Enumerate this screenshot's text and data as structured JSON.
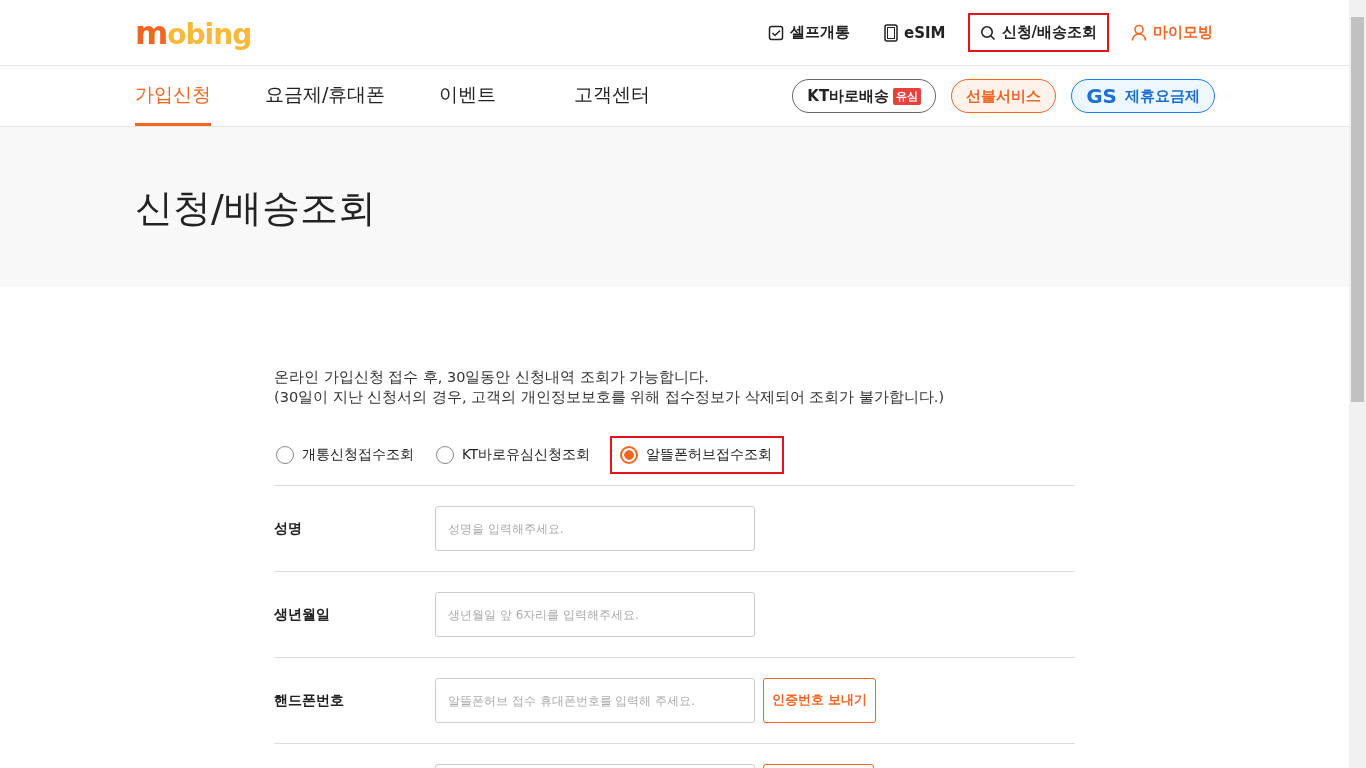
{
  "header": {
    "logo": "mobing",
    "utility_links": [
      {
        "kind": "check",
        "label": "셀프개통",
        "highlighted": false
      },
      {
        "kind": "sim",
        "label": "eSIM",
        "highlighted": false
      },
      {
        "kind": "search",
        "label": "신청/배송조회",
        "highlighted": true
      },
      {
        "kind": "user",
        "label": "마이모빙",
        "highlighted": false
      }
    ]
  },
  "nav": {
    "tabs": [
      {
        "label": "가입신청",
        "selected": true
      },
      {
        "label": "요금제/휴대폰",
        "selected": false
      },
      {
        "label": "이벤트",
        "selected": false
      },
      {
        "label": "고객센터",
        "selected": false
      }
    ],
    "pills": [
      {
        "kind": "kt",
        "label": "KT바로배송",
        "badge": "유심"
      },
      {
        "kind": "prepaid",
        "label": "선불서비스"
      },
      {
        "kind": "gs",
        "prefix": "GS",
        "label": "제휴요금제"
      }
    ]
  },
  "page_title": "신청/배송조회",
  "notice": [
    "온라인 가입신청 접수 후, 30일동안 신청내역 조회가 가능합니다.",
    "(30일이 지난 신청서의 경우, 고객의 개인정보보호를 위해 접수정보가 삭제되어 조회가 불가합니다.)"
  ],
  "lookup_types": [
    {
      "label": "개통신청접수조회",
      "selected": false,
      "highlighted": false
    },
    {
      "label": "KT바로유심신청조회",
      "selected": false,
      "highlighted": false
    },
    {
      "label": "알뜰폰허브접수조회",
      "selected": true,
      "highlighted": true
    }
  ],
  "form_rows": [
    {
      "label": "성명",
      "placeholder": "성명을 입력해주세요."
    },
    {
      "label": "생년월일",
      "placeholder": "생년월일 앞 6자리를 입력해주세요."
    },
    {
      "label": "핸드폰번호",
      "placeholder": "알뜰폰허브 접수 휴대폰번호를 입력해 주세요.",
      "button": "인증번호 보내기"
    },
    {
      "kind": "cut",
      "has_button": true
    }
  ]
}
